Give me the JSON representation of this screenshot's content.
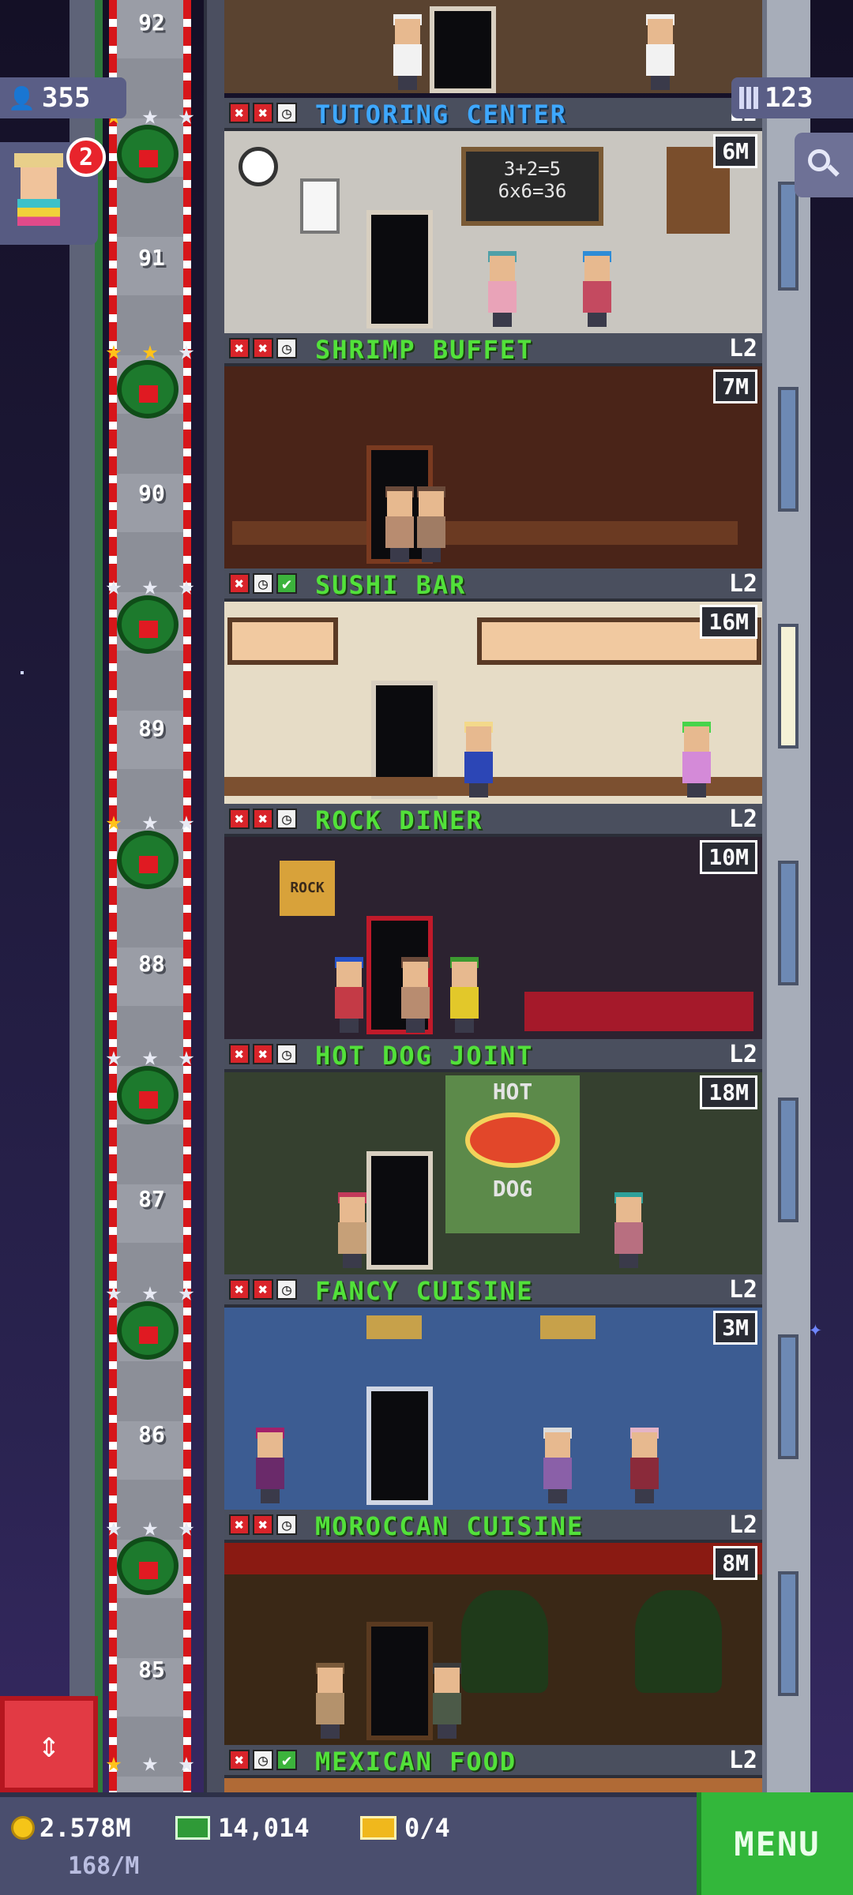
{
  "hud": {
    "population": "355",
    "floors_count": "123",
    "notification_count": "2",
    "coins": "2.578M",
    "coin_rate": "168/M",
    "bux": "14,014",
    "tickets": "0/4",
    "menu_label": "MENU"
  },
  "elevator": {
    "floor_numbers": [
      "92",
      "91",
      "90",
      "89",
      "88",
      "87",
      "86",
      "85"
    ]
  },
  "floors": [
    {
      "name": "TUTORING CENTER",
      "level": "L2",
      "income": "6M",
      "status": [
        "x",
        "x",
        "c"
      ]
    },
    {
      "name": "SHRIMP BUFFET",
      "level": "L2",
      "income": "7M",
      "status": [
        "x",
        "x",
        "c"
      ]
    },
    {
      "name": "SUSHI BAR",
      "level": "L2",
      "income": "16M",
      "status": [
        "x",
        "c",
        "k"
      ]
    },
    {
      "name": "ROCK DINER",
      "level": "L2",
      "income": "10M",
      "status": [
        "x",
        "x",
        "c"
      ]
    },
    {
      "name": "HOT DOG JOINT",
      "level": "L2",
      "income": "18M",
      "status": [
        "x",
        "x",
        "c"
      ]
    },
    {
      "name": "FANCY CUISINE",
      "level": "L2",
      "income": "3M",
      "status": [
        "x",
        "x",
        "c"
      ]
    },
    {
      "name": "MOROCCAN CUISINE",
      "level": "L2",
      "income": "8M",
      "status": [
        "x",
        "x",
        "c"
      ]
    },
    {
      "name": "MEXICAN FOOD",
      "level": "L2",
      "income": "",
      "status": [
        "x",
        "c",
        "k"
      ]
    }
  ],
  "floor_art": {
    "chalkboard_line1": "3+2=5",
    "chalkboard_line2": "6x6=36",
    "rock_sign": "ROCK",
    "hot_sign": "HOT",
    "dog_sign": "DOG"
  },
  "colors": {
    "floor_name_green": "#52e13a",
    "floor_name_blue": "#3ea8ff",
    "menu_green": "#33b73b",
    "status_red": "#d9242a"
  },
  "icons": {
    "population": "person-icon",
    "floors": "building-icon",
    "search": "magnifier-icon",
    "elevator": "up-down-arrows-icon",
    "coins": "coin-icon",
    "bux": "tower-bux-icon",
    "tickets": "ticket-icon"
  }
}
